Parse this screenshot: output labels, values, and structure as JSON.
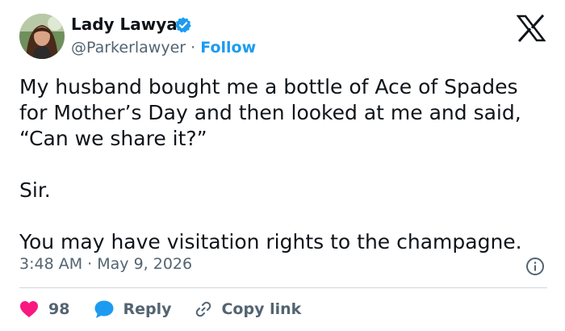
{
  "author": {
    "name": "Lady Lawya",
    "handle": "@Parkerlawyer",
    "separator": "·",
    "follow_label": "Follow"
  },
  "tweet": {
    "lines": [
      "My husband bought me a bottle of Ace of Spades",
      "for Mother’s Day and then looked at me and said,",
      "“Can we share it?”",
      "Sir.",
      "You may have visitation rights to the champagne."
    ],
    "time": "3:48 AM",
    "separator": "·",
    "date": "May 9, 2026"
  },
  "actions": {
    "like_count": "98",
    "reply_label": "Reply",
    "copy_link_label": "Copy link"
  },
  "colors": {
    "accent": "#1d9bf0",
    "heart": "#f91880",
    "secondary_text": "#536471",
    "primary_text": "#0f1419",
    "divider": "#cfd9de"
  },
  "icons": [
    "verified-badge-icon",
    "x-logo-icon",
    "info-icon",
    "heart-icon",
    "reply-bubble-icon",
    "link-icon"
  ]
}
